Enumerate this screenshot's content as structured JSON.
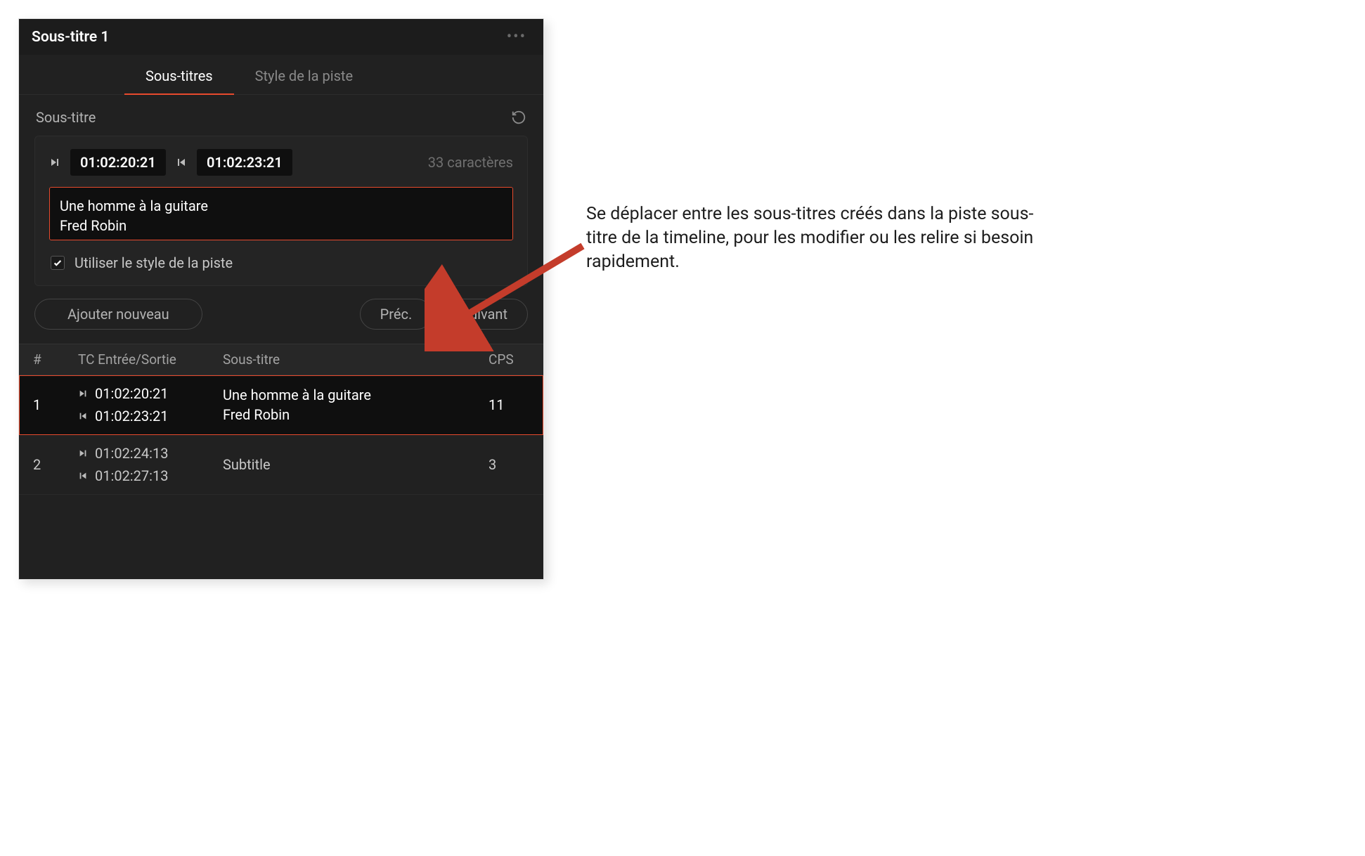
{
  "panel": {
    "title": "Sous-titre 1"
  },
  "tabs": {
    "subtitles": "Sous-titres",
    "track_style": "Style de la piste"
  },
  "section": {
    "label": "Sous-titre"
  },
  "editor": {
    "tc_in": "01:02:20:21",
    "tc_out": "01:02:23:21",
    "char_count": "33 caractères",
    "text": "Une homme à la guitare\nFred Robin",
    "use_track_style_label": "Utiliser le style de la piste",
    "use_track_style_checked": true
  },
  "buttons": {
    "add_new": "Ajouter nouveau",
    "prev": "Préc.",
    "next": "Suivant"
  },
  "table": {
    "headers": {
      "index": "#",
      "tc": "TC Entrée/Sortie",
      "subtitle": "Sous-titre",
      "cps": "CPS"
    },
    "rows": [
      {
        "index": "1",
        "tc_in": "01:02:20:21",
        "tc_out": "01:02:23:21",
        "text": "Une homme à la guitare\nFred Robin",
        "cps": "11",
        "selected": true
      },
      {
        "index": "2",
        "tc_in": "01:02:24:13",
        "tc_out": "01:02:27:13",
        "text": "Subtitle",
        "cps": "3",
        "selected": false
      }
    ]
  },
  "annotation": {
    "text": "Se déplacer entre les sous-titres créés dans la piste sous-titre de la timeline, pour les modifier ou les relire si besoin rapidement."
  },
  "colors": {
    "accent": "#e74a2d",
    "arrow": "#c43c2b"
  }
}
